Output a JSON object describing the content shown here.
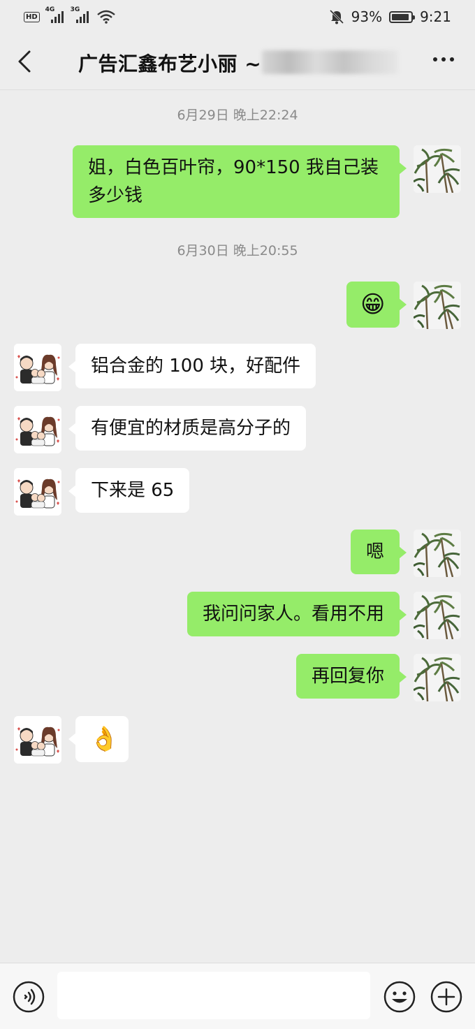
{
  "status_bar": {
    "hd_badge": "HD",
    "sim1_label": "4G",
    "sim2_label": "3G",
    "battery_percent": "93%",
    "battery_level": 0.93,
    "time": "9:21",
    "icons": [
      "hd-icon",
      "signal-icon",
      "signal-icon",
      "wifi-icon",
      "mute-bell-icon",
      "battery-icon"
    ]
  },
  "header": {
    "title": "广告汇鑫布艺小丽 ~",
    "icons": [
      "back-arrow-icon",
      "more-dots-icon"
    ]
  },
  "messages": [
    {
      "type": "timestamp",
      "text": "6月29日 晚上22:24"
    },
    {
      "type": "message",
      "side": "right",
      "text": "姐，白色百叶帘，90*150 我自己装多少钱"
    },
    {
      "type": "timestamp",
      "text": "6月30日 晚上20:55"
    },
    {
      "type": "message",
      "side": "right",
      "emoji": "😁",
      "emoji_name": "grinning-emoji"
    },
    {
      "type": "message",
      "side": "left",
      "text": "铝合金的 100 块，好配件"
    },
    {
      "type": "message",
      "side": "left",
      "text": "有便宜的材质是高分子的"
    },
    {
      "type": "message",
      "side": "left",
      "text": "下来是 65"
    },
    {
      "type": "message",
      "side": "right",
      "text": "嗯"
    },
    {
      "type": "message",
      "side": "right",
      "text": "我问问家人。看用不用"
    },
    {
      "type": "message",
      "side": "right",
      "text": "再回复你"
    },
    {
      "type": "message",
      "side": "left",
      "emoji": "👌",
      "emoji_name": "ok-hand-emoji"
    }
  ],
  "input_bar": {
    "input_value": "",
    "icons": [
      "voice-icon",
      "emoji-face-icon",
      "plus-icon"
    ]
  },
  "colors": {
    "background": "#ededed",
    "sent_bubble": "#95ec69",
    "received_bubble": "#ffffff",
    "timestamp_text": "#8a8a8a"
  }
}
